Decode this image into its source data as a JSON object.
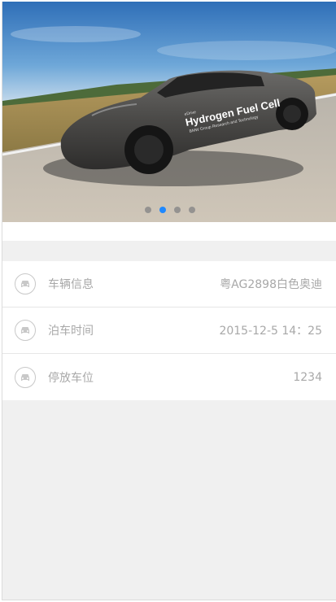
{
  "banner": {
    "image_alt": "Hydrogen Fuel Cell car",
    "car_text_main": "Hydrogen Fuel Cell",
    "car_text_small": "BMW Group Research and Technology",
    "car_text_top": "eDrive",
    "slides": 4,
    "active_slide": 2
  },
  "info": {
    "rows": [
      {
        "icon": "car-icon",
        "label": "车辆信息",
        "value": "粤AG2898白色奥迪"
      },
      {
        "icon": "car-icon",
        "label": "泊车时间",
        "value": "2015-12-5 14：25"
      },
      {
        "icon": "car-icon",
        "label": "停放车位",
        "value": "1234"
      }
    ]
  },
  "colors": {
    "accent": "#1e88ff",
    "background": "#f0f0f0",
    "text_muted": "#a8a8a8"
  }
}
